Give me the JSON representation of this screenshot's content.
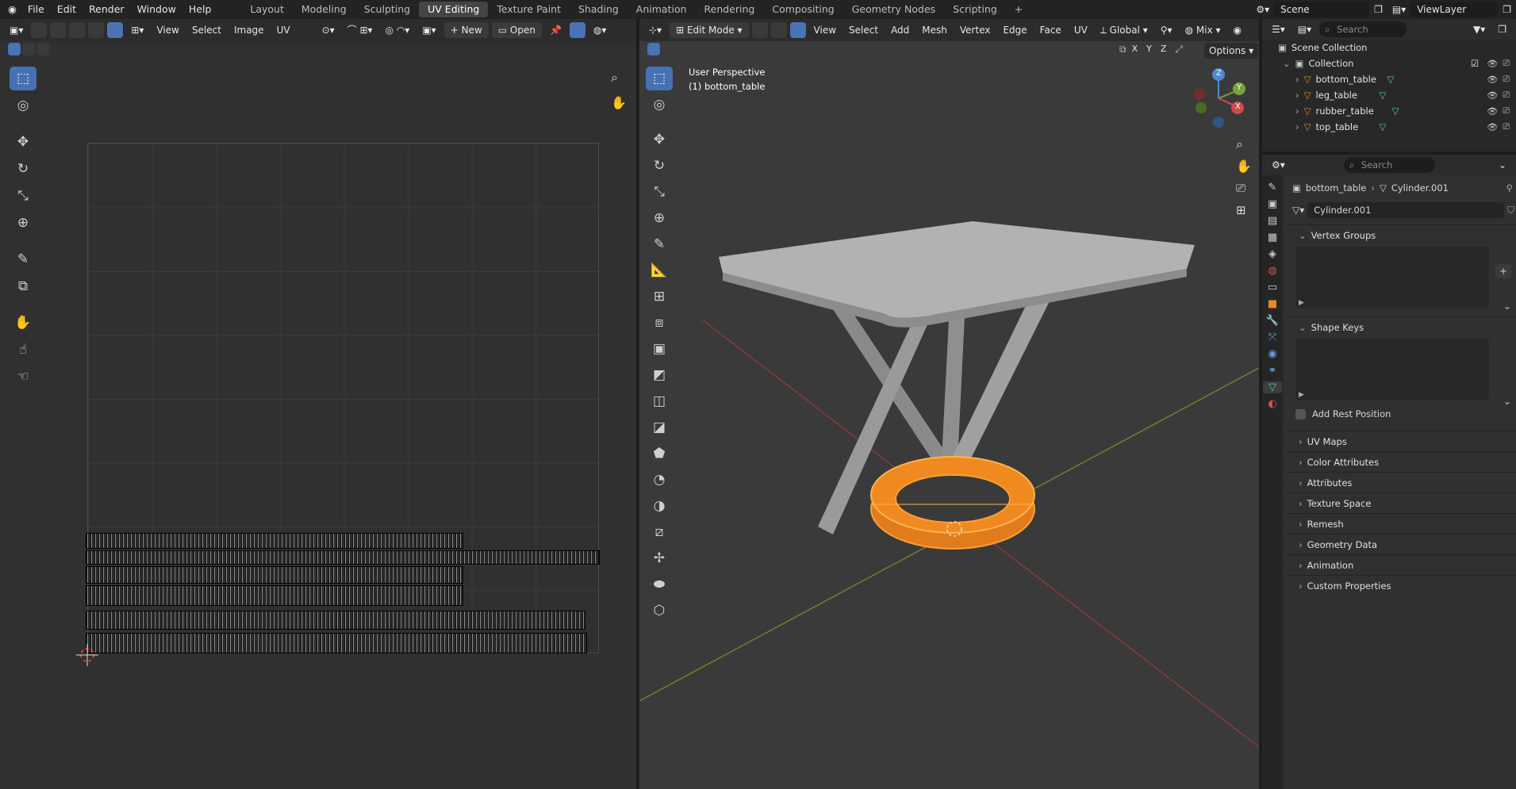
{
  "topbar": {
    "menus": [
      "File",
      "Edit",
      "Render",
      "Window",
      "Help"
    ],
    "workspaces": [
      "Layout",
      "Modeling",
      "Sculpting",
      "UV Editing",
      "Texture Paint",
      "Shading",
      "Animation",
      "Rendering",
      "Compositing",
      "Geometry Nodes",
      "Scripting"
    ],
    "active_workspace": "UV Editing",
    "add_tab": "+",
    "scene": "Scene",
    "view_layer": "ViewLayer"
  },
  "uv_editor": {
    "menus": [
      "View",
      "Select",
      "Image",
      "UV"
    ],
    "new_label": "New",
    "open_label": "Open"
  },
  "viewport": {
    "mode": "Edit Mode",
    "menus": [
      "View",
      "Select",
      "Add",
      "Mesh",
      "Vertex",
      "Edge",
      "Face",
      "UV"
    ],
    "orientation": "Global",
    "blend": "Mix",
    "options": "Options",
    "overlay_title": "User Perspective",
    "overlay_object": "(1) bottom_table",
    "axes": [
      "X",
      "Y",
      "Z"
    ]
  },
  "outliner": {
    "search_placeholder": "Search",
    "scene_collection": "Scene Collection",
    "collection": "Collection",
    "objects": [
      "bottom_table",
      "leg_table",
      "rubber_table",
      "top_table"
    ]
  },
  "properties": {
    "search_placeholder": "Search",
    "breadcrumb_object": "bottom_table",
    "breadcrumb_mesh": "Cylinder.001",
    "mesh_name": "Cylinder.001",
    "vertex_groups": "Vertex Groups",
    "shape_keys": "Shape Keys",
    "add_rest_position": "Add Rest Position",
    "collapsed_panels": [
      "UV Maps",
      "Color Attributes",
      "Attributes",
      "Texture Space",
      "Remesh",
      "Geometry Data",
      "Animation",
      "Custom Properties"
    ]
  },
  "colors": {
    "accent": "#4672b3",
    "selection": "#ff8c1a",
    "bg": "#1d1d1d",
    "panel": "#303030"
  }
}
